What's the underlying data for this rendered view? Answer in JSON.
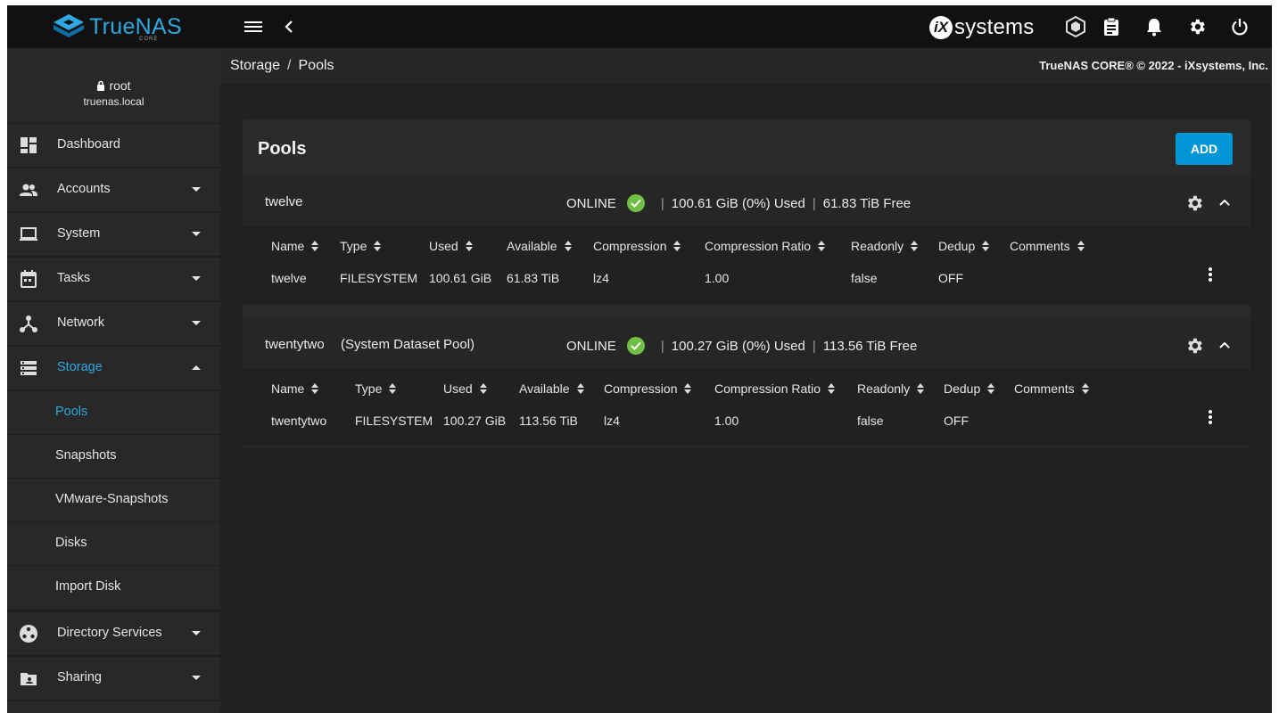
{
  "header": {
    "brand": "TrueNAS",
    "brand_sub": "CORE",
    "vendor": "systems",
    "vendor_mark": "iX"
  },
  "user": {
    "name": "root",
    "host": "truenas.local"
  },
  "sidebar": {
    "items": [
      {
        "label": "Dashboard",
        "icon": "dashboard-icon"
      },
      {
        "label": "Accounts",
        "icon": "accounts-icon"
      },
      {
        "label": "System",
        "icon": "laptop-icon"
      },
      {
        "label": "Tasks",
        "icon": "calendar-icon"
      },
      {
        "label": "Network",
        "icon": "network-icon"
      },
      {
        "label": "Storage",
        "icon": "storage-icon"
      }
    ],
    "storage_sub": [
      "Pools",
      "Snapshots",
      "VMware-Snapshots",
      "Disks",
      "Import Disk"
    ],
    "more": [
      {
        "label": "Directory Services",
        "icon": "directory-icon"
      },
      {
        "label": "Sharing",
        "icon": "sharing-icon"
      }
    ]
  },
  "breadcrumb": {
    "parent": "Storage",
    "current": "Pools",
    "separator": "/"
  },
  "copyright": "TrueNAS CORE® © 2022 - iXsystems, Inc.",
  "pools_card": {
    "title": "Pools",
    "add_label": "ADD"
  },
  "columns": [
    "Name",
    "Type",
    "Used",
    "Available",
    "Compression",
    "Compression Ratio",
    "Readonly",
    "Dedup",
    "Comments"
  ],
  "pools": [
    {
      "name": "twelve",
      "desc": "",
      "status": "ONLINE",
      "used": "100.61 GiB (0%) Used",
      "free": "61.83 TiB Free",
      "row": [
        "twelve",
        "FILESYSTEM",
        "100.61 GiB",
        "61.83 TiB",
        "lz4",
        "1.00",
        "false",
        "OFF",
        ""
      ]
    },
    {
      "name": "twentytwo",
      "desc": "(System Dataset Pool)",
      "status": "ONLINE",
      "used": "100.27 GiB (0%) Used",
      "free": "113.56 TiB Free",
      "row": [
        "twentytwo",
        "FILESYSTEM",
        "100.27 GiB",
        "113.56 TiB",
        "lz4",
        "1.00",
        "false",
        "OFF",
        ""
      ]
    }
  ],
  "colors": {
    "accent": "#2da8e0",
    "button": "#0095d5",
    "online": "#71bf44"
  }
}
